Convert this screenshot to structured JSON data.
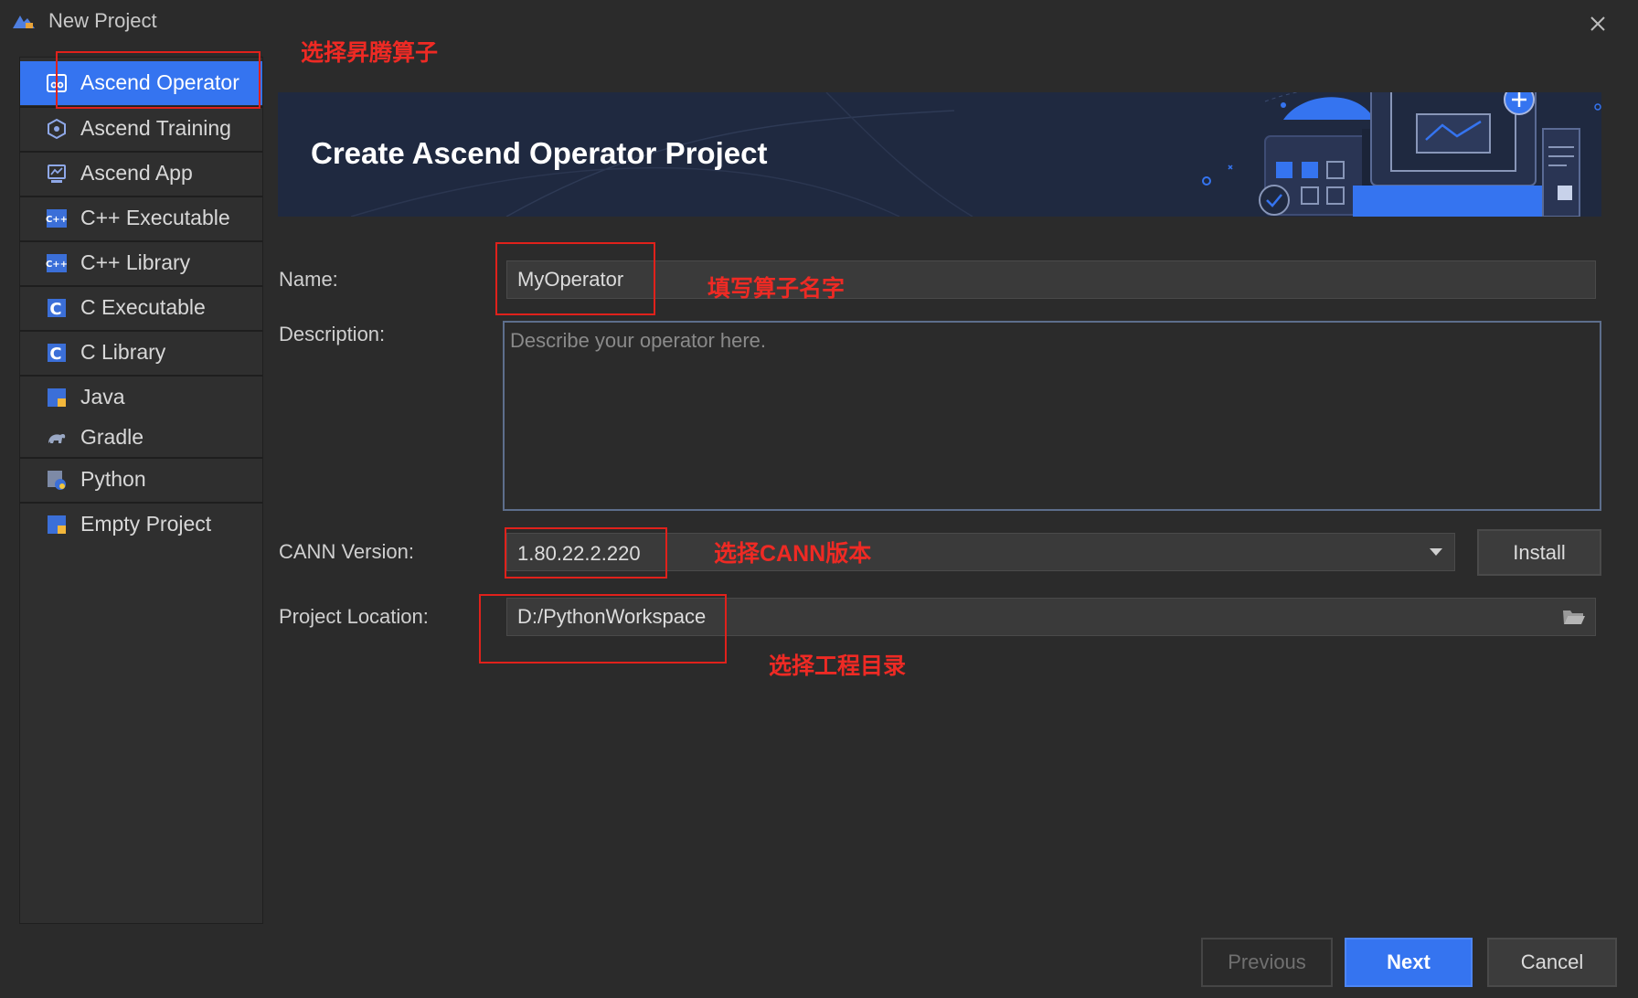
{
  "window": {
    "title": "New Project",
    "close_icon": "close-icon"
  },
  "sidebar": {
    "items": [
      {
        "label": "Ascend Operator",
        "icon": "ascend-operator-icon",
        "active": true
      },
      {
        "label": "Ascend Training",
        "icon": "ascend-training-icon"
      },
      {
        "label": "Ascend App",
        "icon": "ascend-app-icon"
      },
      {
        "label": "C++ Executable",
        "icon": "cpp-executable-icon"
      },
      {
        "label": "C++ Library",
        "icon": "cpp-library-icon"
      },
      {
        "label": "C Executable",
        "icon": "c-executable-icon"
      },
      {
        "label": "C Library",
        "icon": "c-library-icon"
      },
      {
        "label": "Java",
        "icon": "java-icon"
      },
      {
        "label": "Gradle",
        "icon": "gradle-icon"
      },
      {
        "label": "Python",
        "icon": "python-icon"
      },
      {
        "label": "Empty Project",
        "icon": "empty-project-icon"
      }
    ]
  },
  "banner": {
    "title": "Create Ascend Operator Project"
  },
  "form": {
    "name_label": "Name:",
    "name_value": "MyOperator",
    "description_label": "Description:",
    "description_placeholder": "Describe your operator here.",
    "cann_label": "CANN Version:",
    "cann_value": "1.80.22.2.220",
    "install_label": "Install",
    "location_label": "Project Location:",
    "location_value": "D:/PythonWorkspace"
  },
  "footer": {
    "previous": "Previous",
    "next": "Next",
    "cancel": "Cancel"
  },
  "annotations": {
    "select_ascend_operator": "选择昇腾算子",
    "fill_operator_name": "填写算子名字",
    "select_cann_version": "选择CANN版本",
    "select_project_dir": "选择工程目录"
  },
  "colors": {
    "accent": "#3574f0",
    "annotation": "#e0211b",
    "background": "#2b2b2b"
  }
}
